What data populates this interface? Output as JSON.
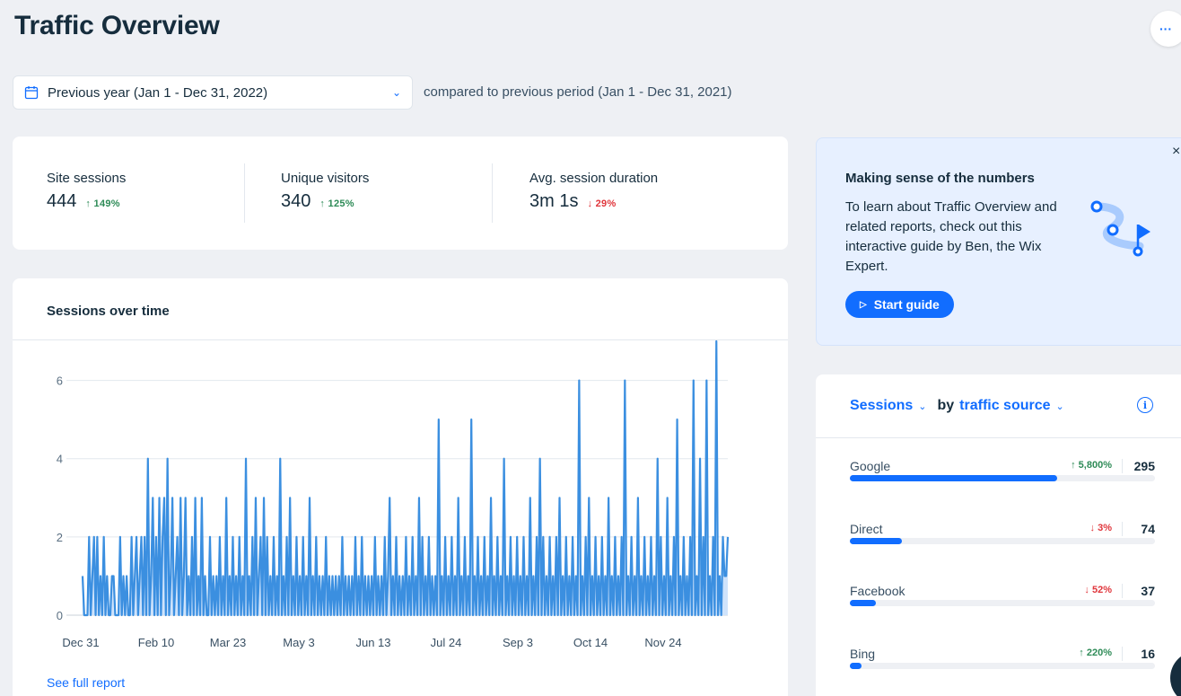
{
  "header": {
    "title": "Traffic Overview",
    "more_label": "···"
  },
  "date_filter": {
    "selected": "Previous year (Jan 1 - Dec 31, 2022)",
    "compare_text": "compared to previous period (Jan 1 - Dec 31, 2021)"
  },
  "stats": [
    {
      "label": "Site sessions",
      "value": "444",
      "delta": "↑ 149%",
      "direction": "up"
    },
    {
      "label": "Unique visitors",
      "value": "340",
      "delta": "↑ 125%",
      "direction": "up"
    },
    {
      "label": "Avg. session duration",
      "value": "3m 1s",
      "delta": "↓ 29%",
      "direction": "down"
    }
  ],
  "sessions_chart": {
    "title": "Sessions over time",
    "see_full_report": "See full report"
  },
  "chart_data": {
    "type": "area",
    "title": "Sessions over time",
    "xlabel": "",
    "ylabel": "",
    "ylim": [
      0,
      7
    ],
    "yticks": [
      0,
      2,
      4,
      6
    ],
    "xticks": [
      "Dec 31",
      "Feb 10",
      "Mar 23",
      "May 3",
      "Jun 13",
      "Jul 24",
      "Sep 3",
      "Oct 14",
      "Nov 24"
    ],
    "x_start": "Dec 31",
    "grid": true,
    "color": "#3b8fe0",
    "series": [
      {
        "values": [
          1,
          0,
          0,
          0,
          2,
          0,
          1,
          2,
          0,
          2,
          0,
          1,
          0,
          2,
          0,
          1,
          0,
          0,
          1,
          1,
          0,
          0,
          0,
          2,
          0,
          1,
          0,
          1,
          0,
          0,
          2,
          0,
          1,
          2,
          0,
          1,
          2,
          0,
          2,
          0,
          4,
          0,
          1,
          3,
          0,
          2,
          0,
          3,
          0,
          2,
          3,
          0,
          4,
          0,
          1,
          3,
          0,
          1,
          2,
          0,
          3,
          0,
          1,
          3,
          0,
          1,
          0,
          2,
          0,
          3,
          0,
          1,
          0,
          3,
          0,
          1,
          0,
          0,
          2,
          0,
          1,
          0,
          1,
          0,
          2,
          0,
          1,
          0,
          3,
          0,
          1,
          0,
          2,
          0,
          1,
          0,
          2,
          0,
          1,
          0,
          4,
          0,
          1,
          0,
          2,
          0,
          3,
          0,
          1,
          2,
          0,
          3,
          0,
          2,
          0,
          1,
          0,
          2,
          0,
          1,
          0,
          4,
          0,
          1,
          0,
          2,
          0,
          3,
          0,
          1,
          0,
          2,
          0,
          1,
          0,
          2,
          0,
          1,
          0,
          3,
          0,
          1,
          0,
          2,
          0,
          1,
          0,
          1,
          0,
          2,
          0,
          1,
          0,
          1,
          0,
          1,
          0,
          1,
          0,
          2,
          0,
          1,
          0,
          1,
          0,
          1,
          0,
          2,
          0,
          1,
          0,
          2,
          0,
          1,
          0,
          1,
          0,
          1,
          0,
          2,
          0,
          1,
          0,
          1,
          0,
          2,
          0,
          1,
          3,
          0,
          1,
          0,
          2,
          0,
          1,
          0,
          1,
          0,
          2,
          0,
          1,
          0,
          2,
          0,
          1,
          0,
          3,
          0,
          2,
          0,
          1,
          0,
          2,
          0,
          1,
          0,
          1,
          0,
          5,
          0,
          1,
          0,
          2,
          0,
          1,
          0,
          2,
          0,
          1,
          0,
          3,
          0,
          1,
          0,
          2,
          0,
          1,
          0,
          5,
          0,
          1,
          0,
          2,
          0,
          1,
          0,
          2,
          0,
          1,
          0,
          3,
          0,
          1,
          0,
          2,
          0,
          1,
          0,
          4,
          0,
          1,
          0,
          2,
          0,
          1,
          0,
          2,
          0,
          1,
          0,
          2,
          0,
          1,
          0,
          3,
          0,
          1,
          0,
          2,
          0,
          4,
          0,
          2,
          0,
          1,
          0,
          2,
          0,
          1,
          0,
          2,
          0,
          3,
          0,
          1,
          0,
          2,
          0,
          1,
          0,
          2,
          0,
          1,
          0,
          6,
          0,
          1,
          0,
          2,
          0,
          3,
          0,
          1,
          0,
          2,
          0,
          1,
          0,
          2,
          0,
          1,
          0,
          3,
          0,
          1,
          0,
          2,
          0,
          1,
          0,
          2,
          0,
          6,
          0,
          1,
          0,
          2,
          0,
          1,
          0,
          3,
          0,
          1,
          0,
          2,
          0,
          1,
          0,
          2,
          0,
          1,
          0,
          4,
          0,
          2,
          0,
          1,
          0,
          3,
          0,
          1,
          0,
          2,
          0,
          5,
          0,
          1,
          0,
          2,
          0,
          1,
          0,
          2,
          0,
          6,
          0,
          1,
          0,
          4,
          0,
          2,
          0,
          6,
          0,
          1,
          0,
          2,
          0,
          7,
          0,
          1,
          0,
          2,
          1,
          1,
          2
        ]
      }
    ]
  },
  "guide": {
    "title": "Making sense of the numbers",
    "text": "To learn about Traffic Overview and related reports, check out this interactive guide by Ben, the Wix Expert.",
    "button": "Start guide",
    "close": "×"
  },
  "sources": {
    "metric": "Sessions",
    "by": "by",
    "dimension": "traffic source",
    "info": "i",
    "rows": [
      {
        "name": "Google",
        "delta": "↑ 5,800%",
        "direction": "up",
        "count": "295",
        "share": 0.68
      },
      {
        "name": "Direct",
        "delta": "↓ 3%",
        "direction": "down",
        "count": "74",
        "share": 0.17
      },
      {
        "name": "Facebook",
        "delta": "↓ 52%",
        "direction": "down",
        "count": "37",
        "share": 0.085
      },
      {
        "name": "Bing",
        "delta": "↑ 220%",
        "direction": "up",
        "count": "16",
        "share": 0.037
      }
    ]
  }
}
